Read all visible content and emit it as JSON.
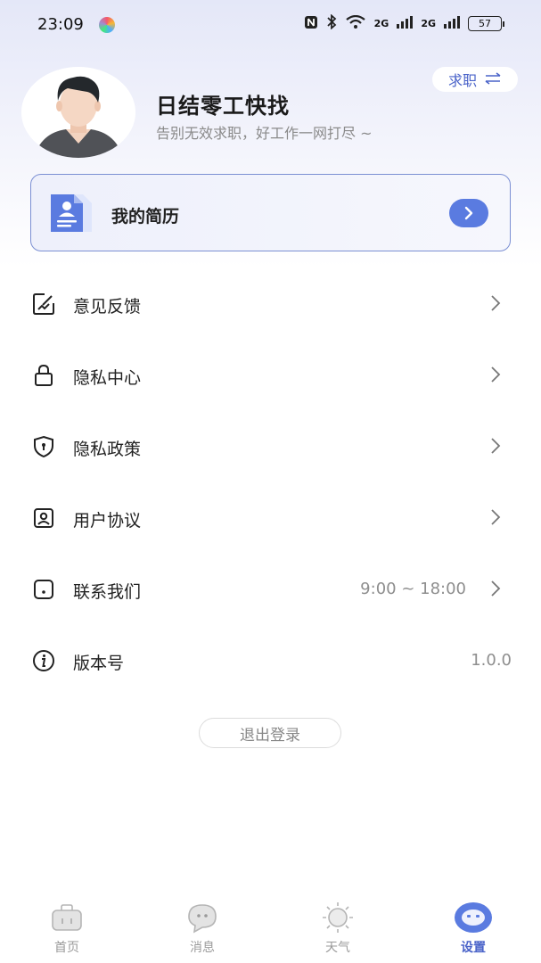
{
  "status_bar": {
    "time": "23:09",
    "icons": [
      "nfc-icon",
      "bluetooth-icon",
      "wifi-icon",
      "signal-icon",
      "signal-icon"
    ],
    "network_1": "2G",
    "network_2": "2G",
    "battery": "57"
  },
  "profile": {
    "app_name": "日结零工快找",
    "slogan": "告别无效求职，好工作一网打尽 ~",
    "mode_label": "求职",
    "mode_icon": "swap-icon"
  },
  "resume": {
    "label": "我的简历",
    "icon": "resume-doc-icon"
  },
  "menu": {
    "items": [
      {
        "label": "意见反馈",
        "icon": "feedback-icon"
      },
      {
        "label": "隐私中心",
        "icon": "lock-icon"
      },
      {
        "label": "隐私政策",
        "icon": "shield-icon"
      },
      {
        "label": "用户协议",
        "icon": "user-card-icon"
      },
      {
        "label": "联系我们",
        "icon": "contact-icon",
        "value": "9:00 ~ 18:00"
      },
      {
        "label": "版本号",
        "icon": "info-icon",
        "value": "1.0.0"
      }
    ]
  },
  "logout_label": "退出登录",
  "tabbar": {
    "tabs": [
      {
        "label": "首页",
        "icon": "home-briefcase-icon"
      },
      {
        "label": "消息",
        "icon": "message-icon"
      },
      {
        "label": "天气",
        "icon": "sun-icon"
      },
      {
        "label": "设置",
        "icon": "settings-face-icon",
        "active": true
      }
    ]
  },
  "colors": {
    "accent": "#4a63c9",
    "accent_button": "#5a7be0",
    "header_gradient_top": "#e4e7f8"
  }
}
